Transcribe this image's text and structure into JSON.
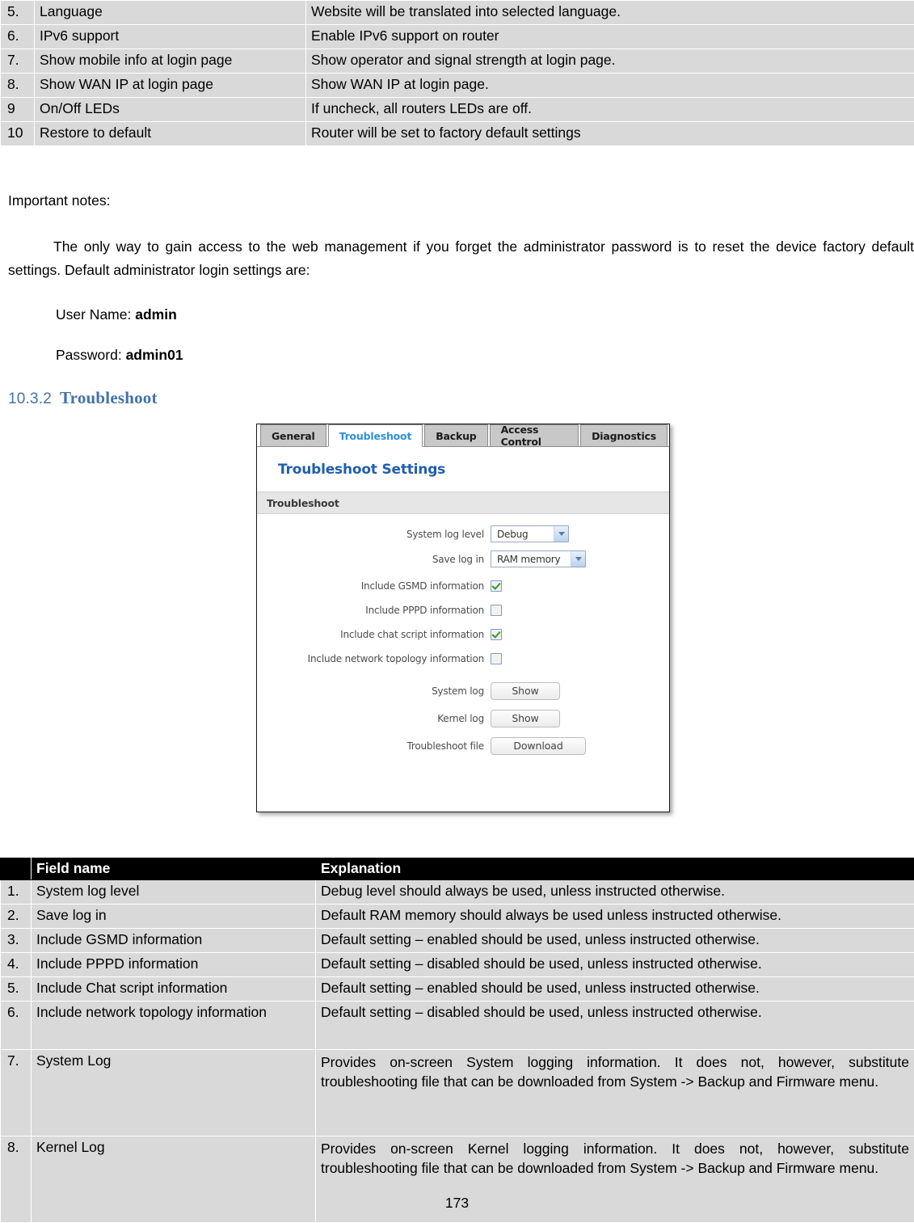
{
  "top_table": {
    "rows": [
      {
        "num": "5.",
        "field": "Language",
        "explanation": "Website will be translated into selected language."
      },
      {
        "num": "6.",
        "field": "IPv6 support",
        "explanation": "Enable IPv6 support on router"
      },
      {
        "num": "7.",
        "field": "Show mobile info at login page",
        "explanation": "Show operator and signal strength at login page."
      },
      {
        "num": "8.",
        "field": "Show WAN IP at login page",
        "explanation": "Show WAN IP at login page."
      },
      {
        "num": "9",
        "field": "On/Off  LEDs",
        "explanation": "If uncheck, all routers LEDs are off."
      },
      {
        "num": "10",
        "field": "Restore to default",
        "explanation": "Router will be set to factory default settings"
      }
    ]
  },
  "notes": {
    "label": "Important notes:",
    "paragraph": "The only way to gain access to the web management if you forget the administrator password is to reset the device factory default settings. Default administrator login settings are:",
    "user_name_label": "User Name:",
    "user_name_value": "admin",
    "password_label": "Password:",
    "password_value": "admin01"
  },
  "heading": {
    "number": "10.3.2",
    "title": "Troubleshoot",
    "color": "#4472a8"
  },
  "screenshot": {
    "tabs": [
      {
        "label": "General",
        "active": false
      },
      {
        "label": "Troubleshoot",
        "active": true
      },
      {
        "label": "Backup",
        "active": false
      },
      {
        "label": "Access Control",
        "active": false
      },
      {
        "label": "Diagnostics",
        "active": false
      }
    ],
    "page_title": "Troubleshoot Settings",
    "section_title": "Troubleshoot",
    "fields": {
      "system_log_level_label": "System log level",
      "system_log_level_value": "Debug",
      "save_log_in_label": "Save log in",
      "save_log_in_value": "RAM memory",
      "include_gsmd_label": "Include GSMD information",
      "include_gsmd_checked": true,
      "include_pppd_label": "Include PPPD information",
      "include_pppd_checked": false,
      "include_chat_label": "Include chat script information",
      "include_chat_checked": true,
      "include_topology_label": "Include network topology information",
      "include_topology_checked": false,
      "system_log_label": "System log",
      "system_log_button": "Show",
      "kernel_log_label": "Kernel log",
      "kernel_log_button": "Show",
      "troubleshoot_file_label": "Troubleshoot file",
      "troubleshoot_file_button": "Download"
    },
    "accent_color": "#2f8fe0",
    "title_color": "#1f5fad"
  },
  "bottom_table": {
    "headers": {
      "num": "",
      "field": "Field name",
      "explanation": "Explanation"
    },
    "rows": [
      {
        "num": "1.",
        "field": "System log level",
        "explanation": "Debug level should always be used, unless instructed otherwise."
      },
      {
        "num": "2.",
        "field": "Save log in",
        "explanation": "Default RAM memory should always be used unless instructed otherwise."
      },
      {
        "num": "3.",
        "field": "Include GSMD information",
        "explanation": "Default setting – enabled should be used, unless instructed otherwise."
      },
      {
        "num": "4.",
        "field": "Include PPPD information",
        "explanation": "Default setting – disabled should be used, unless instructed otherwise."
      },
      {
        "num": "5.",
        "field": "Include Chat script information",
        "explanation": "Default setting – enabled should be used, unless instructed otherwise."
      },
      {
        "num": "6.",
        "field": "Include network topology information",
        "explanation": "Default setting – disabled should be used, unless instructed otherwise."
      },
      {
        "num": "7.",
        "field": "System Log",
        "explanation": "Provides on-screen System logging information. It does not, however, substitute troubleshooting file that can be downloaded from System -> Backup and Firmware menu."
      },
      {
        "num": "8.",
        "field": "Kernel Log",
        "explanation": "Provides on-screen Kernel logging information. It does not, however, substitute troubleshooting file that can be downloaded from System -> Backup and Firmware menu."
      }
    ]
  },
  "page_number": "173"
}
